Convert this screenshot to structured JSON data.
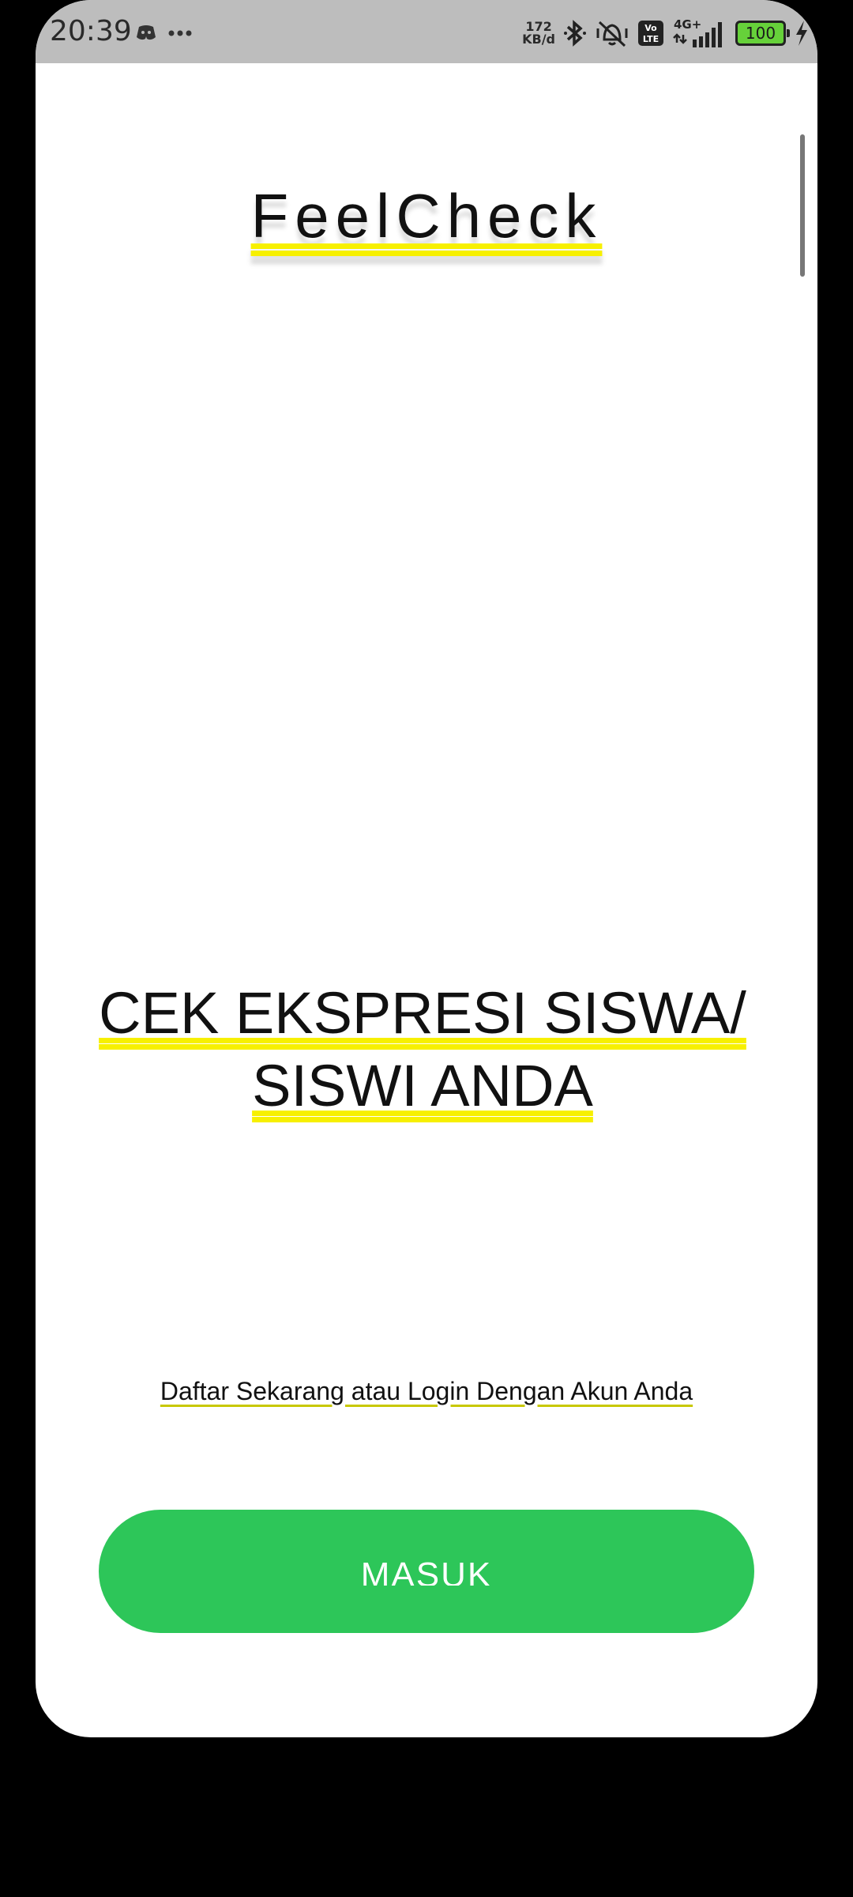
{
  "status_bar": {
    "time": "20:39",
    "left_icons": [
      "discord-icon",
      "more-dots-icon"
    ],
    "speed_value": "172",
    "speed_unit": "KB/d",
    "right_icons": [
      "bluetooth-icon",
      "vibrate-icon",
      "volte-icon",
      "signal-4g-icon",
      "charging-icon"
    ],
    "network": "4G+",
    "battery": "100"
  },
  "app": {
    "title": "FeelCheck",
    "headline": "CEK EKSPRESI SISWA/ SISWI ANDA",
    "subtitle": "Daftar Sekarang atau Login Dengan Akun Anda",
    "button_label": "MASUK"
  },
  "colors": {
    "accent": "#2dc659",
    "status_bar_bg": "#bdbdbd",
    "underline": "#f7f000"
  }
}
